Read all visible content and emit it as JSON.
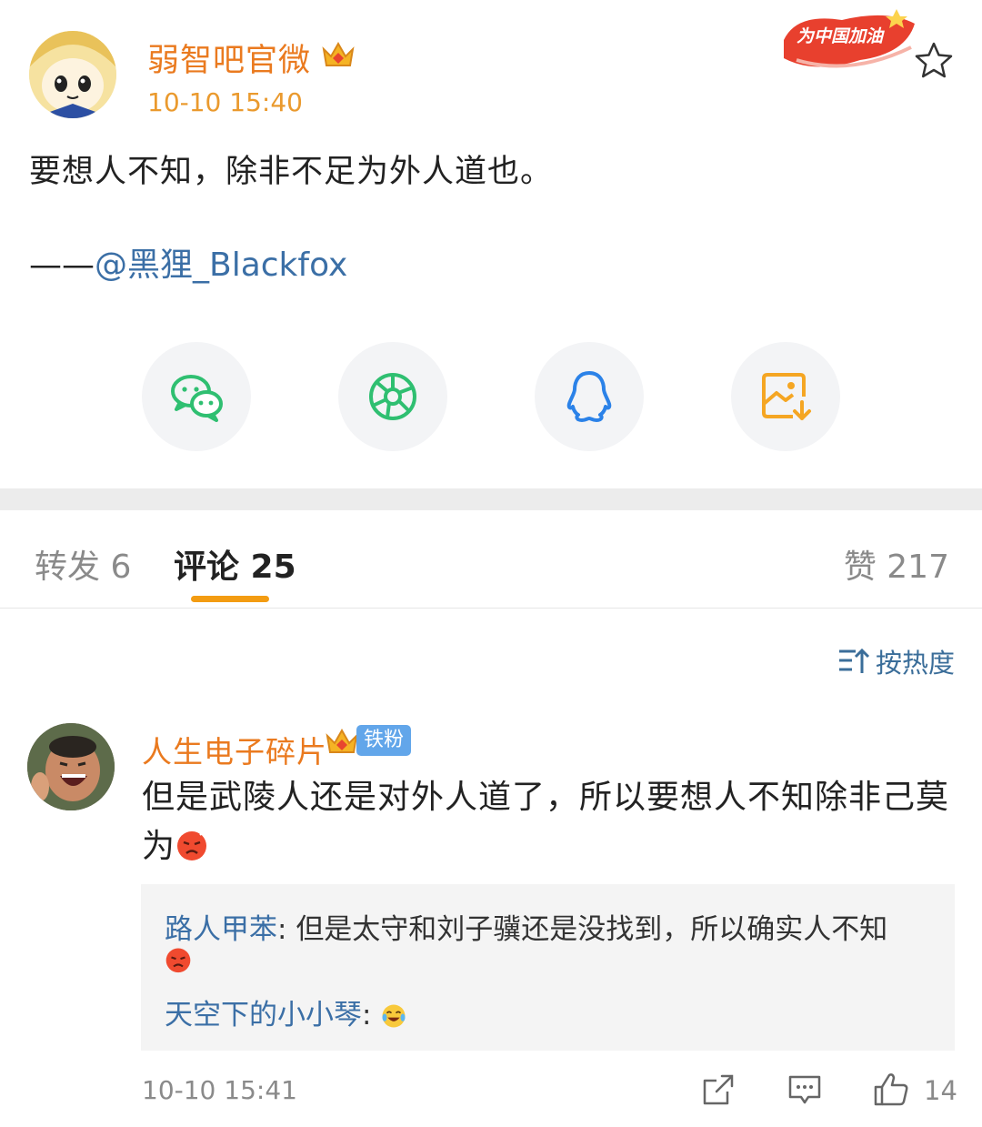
{
  "post": {
    "author": "弱智吧官微",
    "time": "10-10 15:40",
    "event_badge": "为中国加油",
    "text": "要想人不知，除非不足为外人道也。",
    "quote_dash": "——",
    "quote_mention": "@黑狸_Blackfox"
  },
  "share": {
    "items": [
      {
        "icon": "wechat-icon"
      },
      {
        "icon": "moments-icon"
      },
      {
        "icon": "qq-icon"
      },
      {
        "icon": "save-image-icon"
      }
    ]
  },
  "tabs": {
    "repost": "转发 6",
    "comments": "评论 25",
    "likes": "赞 217"
  },
  "sort": {
    "label": "按热度"
  },
  "comment": {
    "author": "人生电子碎片",
    "fan_badge": "铁粉",
    "text": "但是武陵人还是对外人道了，所以要想人不知除非己莫为",
    "replies": [
      {
        "user": "路人甲苯",
        "sep": ": ",
        "text": "但是太守和刘子骥还是没找到，所以确实人不知"
      },
      {
        "user": "天空下的小小琴",
        "sep": ": "
      }
    ],
    "time": "10-10 15:41",
    "like_count": "14"
  },
  "colors": {
    "accent_orange": "#ea7a1f",
    "link_blue": "#3b6fa6",
    "tab_underline": "#f39c12",
    "fan_badge": "#62a6ea"
  }
}
